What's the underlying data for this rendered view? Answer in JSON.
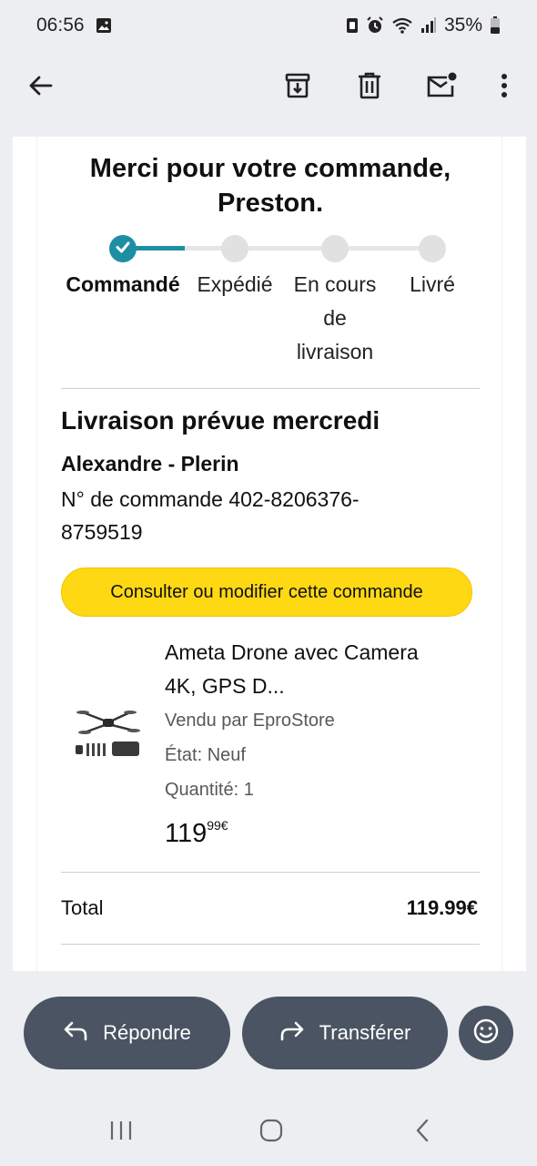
{
  "status_bar": {
    "time": "06:56",
    "battery": "35%",
    "icons": [
      "gallery-icon",
      "nfc-icon",
      "alarm-icon",
      "wifi-icon",
      "signal-icon",
      "battery-icon"
    ]
  },
  "toolbar": {
    "icons": [
      "back-arrow-icon",
      "archive-icon",
      "delete-icon",
      "mark-unread-icon",
      "more-vert-icon"
    ]
  },
  "email": {
    "thanks_line1": "Merci pour votre commande,",
    "thanks_line2": "Preston.",
    "steps": [
      {
        "label_lines": [
          "Commandé"
        ],
        "done": true
      },
      {
        "label_lines": [
          "Expédié"
        ],
        "done": false
      },
      {
        "label_lines": [
          "En cours",
          "de",
          "livraison"
        ],
        "done": false
      },
      {
        "label_lines": [
          "Livré"
        ],
        "done": false
      }
    ],
    "delivery_title": "Livraison prévue mercredi",
    "address": "Alexandre - Plerin",
    "order_number_line1": "N° de commande 402-8206376-",
    "order_number_line2": "8759519",
    "cta_label": "Consulter ou modifier cette commande",
    "product": {
      "title_line1": "Ameta Drone avec Camera",
      "title_line2": "4K, GPS D...",
      "seller": "Vendu par EproStore",
      "condition": "État: Neuf",
      "quantity": "Quantité: 1",
      "price_whole": "119",
      "price_fraction": "99€"
    },
    "total_label": "Total",
    "total_value": "119.99€"
  },
  "actions": {
    "reply_label": "Répondre",
    "forward_label": "Transférer",
    "emoji_icon": "emoji-icon"
  },
  "colors": {
    "accent_teal": "#1e8fa3",
    "cta_yellow": "#ffd814",
    "action_button": "#4a5462",
    "background": "#eceef2"
  }
}
